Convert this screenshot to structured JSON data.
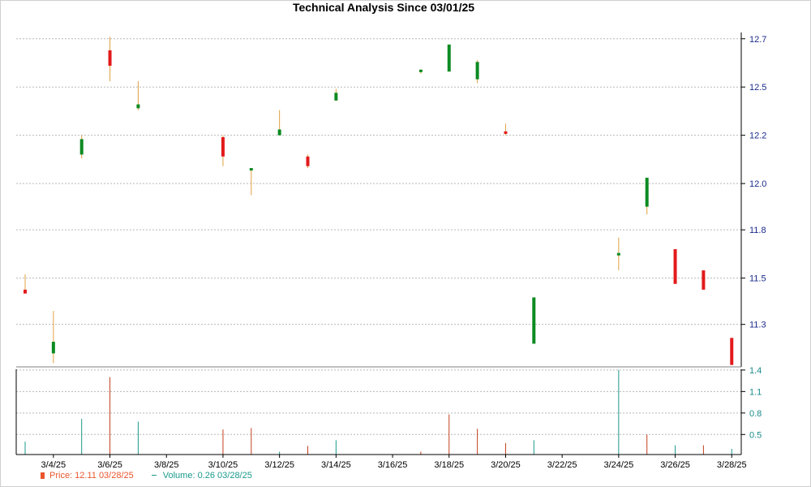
{
  "title": "Technical Analysis Since 03/01/25",
  "colors": {
    "up": "#0c8a22",
    "down": "#e31a1c",
    "wick": "#e0a040",
    "volume_up": "#1a9a8c",
    "volume_down": "#c2401c",
    "grid": "#b8b8b8",
    "axis_price": "#1a2a8a",
    "axis_volume": "#1a8a8a"
  },
  "chart_data": [
    {
      "type": "candlestick",
      "title": "Technical Analysis Since 03/01/25",
      "price_ticks": [
        "11.3",
        "11.5",
        "11.8",
        "12.0",
        "12.2",
        "12.5",
        "12.7"
      ],
      "price_tick_values": [
        11.27,
        11.51,
        11.76,
        12.0,
        12.25,
        12.5,
        12.75
      ],
      "ylim": [
        11.05,
        12.77
      ],
      "date_ticks": [
        "3/4/25",
        "3/6/25",
        "3/8/25",
        "3/10/25",
        "3/12/25",
        "3/14/25",
        "3/16/25",
        "3/18/25",
        "3/20/25",
        "3/22/25",
        "3/24/25",
        "3/26/25",
        "3/28/25"
      ],
      "candles": [
        {
          "date": "3/3/25",
          "open": 11.45,
          "high": 11.53,
          "low": 11.44,
          "close": 11.43
        },
        {
          "date": "3/4/25",
          "open": 11.12,
          "high": 11.34,
          "low": 11.07,
          "close": 11.18
        },
        {
          "date": "3/5/25",
          "open": 12.15,
          "high": 12.25,
          "low": 12.13,
          "close": 12.23
        },
        {
          "date": "3/6/25",
          "open": 12.69,
          "high": 12.76,
          "low": 12.53,
          "close": 12.61
        },
        {
          "date": "3/7/25",
          "open": 12.39,
          "high": 12.53,
          "low": 12.38,
          "close": 12.41
        },
        {
          "date": "3/10/25",
          "open": 12.24,
          "high": 12.25,
          "low": 12.09,
          "close": 12.14
        },
        {
          "date": "3/11/25",
          "open": 12.07,
          "high": 12.08,
          "low": 11.94,
          "close": 12.08
        },
        {
          "date": "3/12/25",
          "open": 12.25,
          "high": 12.38,
          "low": 12.25,
          "close": 12.28
        },
        {
          "date": "3/13/25",
          "open": 12.14,
          "high": 12.15,
          "low": 12.08,
          "close": 12.09
        },
        {
          "date": "3/14/25",
          "open": 12.43,
          "high": 12.49,
          "low": 12.43,
          "close": 12.47
        },
        {
          "date": "3/17/25",
          "open": 12.58,
          "high": 12.59,
          "low": 12.57,
          "close": 12.59
        },
        {
          "date": "3/18/25",
          "open": 12.58,
          "high": 12.72,
          "low": 12.58,
          "close": 12.72
        },
        {
          "date": "3/19/25",
          "open": 12.54,
          "high": 12.64,
          "low": 12.52,
          "close": 12.63
        },
        {
          "date": "3/20/25",
          "open": 12.27,
          "high": 12.31,
          "low": 12.25,
          "close": 12.26
        },
        {
          "date": "3/21/25",
          "open": 11.17,
          "high": 11.41,
          "low": 11.17,
          "close": 11.41
        },
        {
          "date": "3/24/25",
          "open": 11.63,
          "high": 11.72,
          "low": 11.55,
          "close": 11.64
        },
        {
          "date": "3/25/25",
          "open": 11.88,
          "high": 12.03,
          "low": 11.84,
          "close": 12.03
        },
        {
          "date": "3/26/25",
          "open": 11.66,
          "high": 11.66,
          "low": 11.48,
          "close": 11.48
        },
        {
          "date": "3/27/25",
          "open": 11.55,
          "high": 11.55,
          "low": 11.45,
          "close": 11.45
        },
        {
          "date": "3/28/25",
          "open": 11.2,
          "high": 11.2,
          "low": 11.06,
          "close": 11.06
        }
      ],
      "volume_ticks": [
        "0.5",
        "0.8",
        "1.1",
        "1.4"
      ],
      "volume_tick_values": [
        0.5,
        0.8,
        1.1,
        1.4
      ],
      "volume_lim": [
        0.22,
        1.41
      ],
      "volumes": [
        {
          "date": "3/3/25",
          "value": 0.4,
          "dir": "up"
        },
        {
          "date": "3/4/25",
          "value": 0.0,
          "dir": "up"
        },
        {
          "date": "3/5/25",
          "value": 0.72,
          "dir": "up"
        },
        {
          "date": "3/6/25",
          "value": 1.3,
          "dir": "down"
        },
        {
          "date": "3/7/25",
          "value": 0.68,
          "dir": "up"
        },
        {
          "date": "3/10/25",
          "value": 0.57,
          "dir": "down"
        },
        {
          "date": "3/11/25",
          "value": 0.59,
          "dir": "down"
        },
        {
          "date": "3/12/25",
          "value": 0.26,
          "dir": "up"
        },
        {
          "date": "3/13/25",
          "value": 0.34,
          "dir": "down"
        },
        {
          "date": "3/14/25",
          "value": 0.42,
          "dir": "up"
        },
        {
          "date": "3/17/25",
          "value": 0.26,
          "dir": "down"
        },
        {
          "date": "3/18/25",
          "value": 0.78,
          "dir": "down"
        },
        {
          "date": "3/19/25",
          "value": 0.58,
          "dir": "down"
        },
        {
          "date": "3/20/25",
          "value": 0.38,
          "dir": "down"
        },
        {
          "date": "3/21/25",
          "value": 0.42,
          "dir": "up"
        },
        {
          "date": "3/24/25",
          "value": 1.4,
          "dir": "up"
        },
        {
          "date": "3/25/25",
          "value": 0.5,
          "dir": "down"
        },
        {
          "date": "3/26/25",
          "value": 0.35,
          "dir": "up"
        },
        {
          "date": "3/27/25",
          "value": 0.35,
          "dir": "down"
        },
        {
          "date": "3/28/25",
          "value": 0.3,
          "dir": "up"
        }
      ]
    }
  ],
  "legend": {
    "price": "Price: 12.11  03/28/25",
    "volume": "Volume: 0.26  03/28/25"
  }
}
